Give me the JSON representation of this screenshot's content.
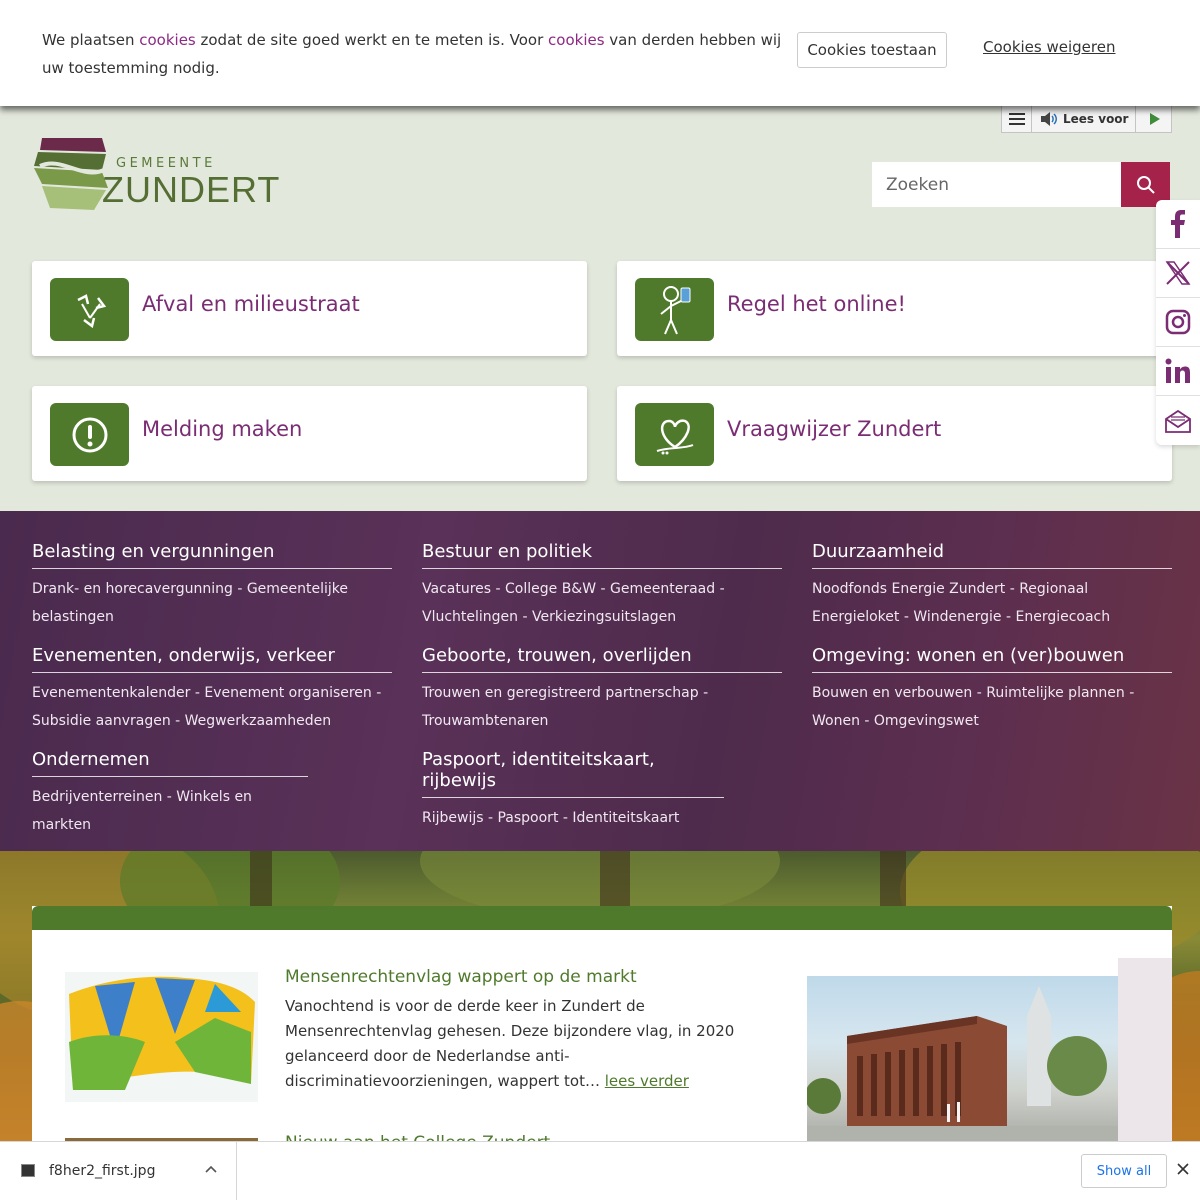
{
  "cookie": {
    "text_part1": "We plaatsen ",
    "link1": "cookies",
    "text_part2": " zodat de site goed werkt en te meten is. Voor ",
    "link2": "cookies",
    "text_part3": " van derden hebben wij uw toestemming nodig.",
    "allow_label": "Cookies toestaan",
    "refuse_label": "Cookies weigeren"
  },
  "readspeaker": {
    "label": "Lees voor"
  },
  "logo": {
    "gemeente": "GEMEENTE",
    "name": "ZUNDERT"
  },
  "search": {
    "placeholder": "Zoeken"
  },
  "tiles": [
    {
      "label": "Afval en milieustraat",
      "icon": "recycle-icon"
    },
    {
      "label": "Regel het online!",
      "icon": "person-phone-icon"
    },
    {
      "label": "Melding maken",
      "icon": "alert-icon"
    },
    {
      "label": "Vraagwijzer Zundert",
      "icon": "heart-icon"
    }
  ],
  "social": [
    "facebook-icon",
    "x-icon",
    "instagram-icon",
    "linkedin-icon",
    "newsletter-icon"
  ],
  "nav": [
    {
      "title": "Belasting en vergunningen",
      "links": "Drank- en horecavergunning - Gemeentelijke belastingen"
    },
    {
      "title": "Bestuur en politiek",
      "links": "Vacatures - College B&W - Gemeenteraad - Vluchtelingen - Verkiezingsuitslagen"
    },
    {
      "title": "Duurzaamheid",
      "links": "Noodfonds Energie Zundert - Regionaal Energieloket - Windenergie - Energiecoach"
    },
    {
      "title": "Evenementen, onderwijs, verkeer",
      "links": "Evenementenkalender - Evenement organiseren - Subsidie aanvragen - Wegwerkzaamheden"
    },
    {
      "title": "Geboorte, trouwen, overlijden",
      "links": "Trouwen en geregistreerd partnerschap - Trouwambtenaren"
    },
    {
      "title": "Omgeving: wonen en (ver)bouwen",
      "links": "Bouwen en verbouwen - Ruimtelijke plannen - Wonen - Omgevingswet"
    },
    {
      "title": "Ondernemen",
      "links": "Bedrijventerreinen - Winkels en markten"
    },
    {
      "title": "Paspoort, identiteitskaart, rijbewijs",
      "links": "Rijbewijs - Paspoort - Identiteitskaart"
    }
  ],
  "news": {
    "item1_title": "Mensenrechtenvlag wappert op de markt",
    "item1_body": "Vanochtend is voor de derde keer in Zundert de Mensenrechtenvlag gehesen. Deze bijzondere vlag, in 2020 gelanceerd door de Nederlandse anti-discriminatievoorzieningen, wappert tot…",
    "item1_more": "lees verder",
    "item2_title": "Nieuw aan het College Zundert"
  },
  "download": {
    "filename": "f8her2_first.jpg",
    "show_all": "Show all"
  },
  "colors": {
    "green": "#4f7a2c",
    "purple": "#7b2d74",
    "search_red": "#a5234a"
  }
}
